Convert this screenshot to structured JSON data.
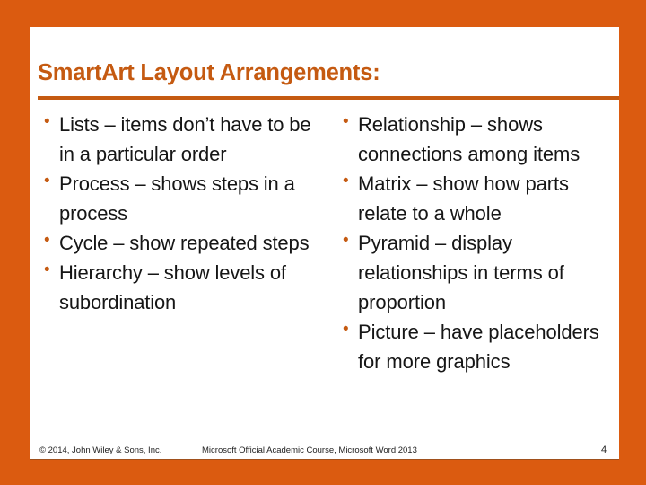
{
  "slide": {
    "title": "SmartArt Layout Arrangements:",
    "accent_color": "#C55A11",
    "border_color": "#DB5B10",
    "background_color": "#FFFFFF",
    "bullet_glyph": "•"
  },
  "columns": {
    "left": [
      {
        "text": "Lists – items don’t have to be in a particular order"
      },
      {
        "text": "Process – shows steps in a process"
      },
      {
        "text": "Cycle – show repeated steps"
      },
      {
        "text": "Hierarchy – show levels of subordination"
      }
    ],
    "right": [
      {
        "text": "Relationship – shows connections among items"
      },
      {
        "text": "Matrix – show how parts relate to a whole"
      },
      {
        "text": "Pyramid – display relationships in terms of proportion"
      },
      {
        "text": "Picture – have placeholders for more graphics"
      }
    ]
  },
  "footer": {
    "copyright": "© 2014, John Wiley & Sons, Inc.",
    "course": "Microsoft Official Academic Course, Microsoft Word 2013",
    "page_number": "4"
  }
}
